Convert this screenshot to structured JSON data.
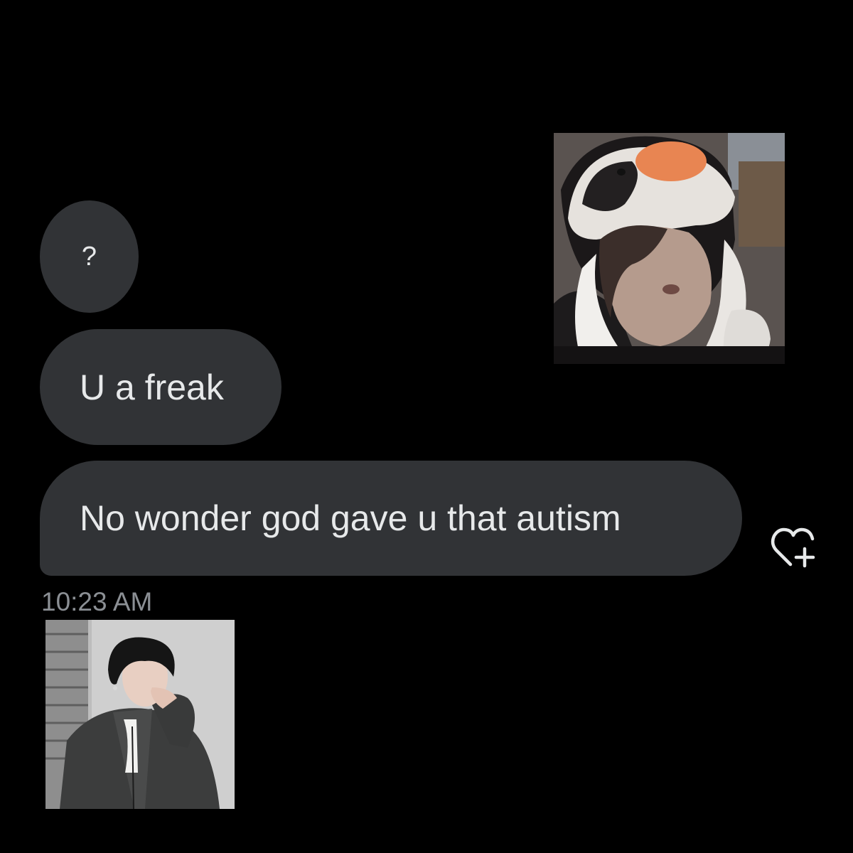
{
  "conversation": {
    "messages": [
      {
        "text": "?"
      },
      {
        "text": "U a freak"
      },
      {
        "text": "No wonder god gave u that autism"
      }
    ],
    "timestamp": "10:23 AM"
  },
  "actions": {
    "react_icon": "heart-plus-icon"
  },
  "colors": {
    "background": "#000000",
    "bubble": "#313336",
    "bubble_text": "#e7e9ea",
    "timestamp_text": "#8b8f94"
  }
}
